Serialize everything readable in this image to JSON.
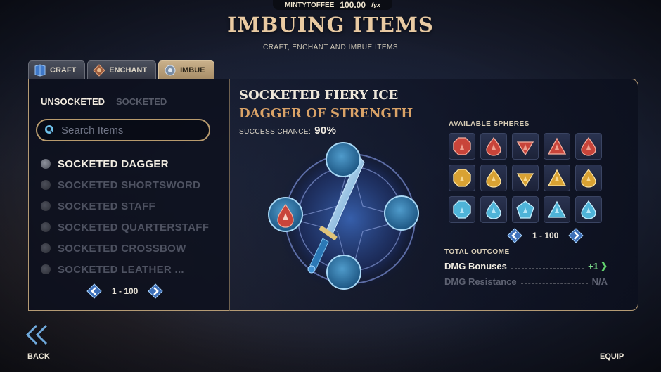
{
  "header": {
    "username": "MINTYTOFFEE",
    "balance": "100.00",
    "currency_unit": "fyx",
    "title": "IMBUING ITEMS",
    "subtitle": "CRAFT, ENCHANT AND IMBUE ITEMS"
  },
  "tabs": [
    {
      "label": "CRAFT",
      "icon": "book-icon",
      "active": false
    },
    {
      "label": "ENCHANT",
      "icon": "enchant-icon",
      "active": false
    },
    {
      "label": "IMBUE",
      "icon": "imbue-icon",
      "active": true
    }
  ],
  "left_panel": {
    "subtabs": [
      {
        "label": "UNSOCKETED",
        "active": true
      },
      {
        "label": "SOCKETED",
        "active": false
      }
    ],
    "search_placeholder": "Search Items",
    "items": [
      {
        "label": "SOCKETED DAGGER",
        "selected": true
      },
      {
        "label": "SOCKETED SHORTSWORD",
        "selected": false
      },
      {
        "label": "SOCKETED STAFF",
        "selected": false
      },
      {
        "label": "SOCKETED QUARTERSTAFF",
        "selected": false
      },
      {
        "label": "SOCKETED CROSSBOW",
        "selected": false
      },
      {
        "label": "SOCKETED LEATHER ...",
        "selected": false
      }
    ],
    "pager": "1 - 100"
  },
  "detail": {
    "name_line1": "SOCKETED FIERY ICE",
    "name_line2": "DAGGER OF STRENGTH",
    "success_label": "SUCCESS CHANCE:",
    "success_value": "90%",
    "sockets": [
      {
        "slot": "top",
        "filled": false
      },
      {
        "slot": "left",
        "filled": true,
        "element": "fire"
      },
      {
        "slot": "right",
        "filled": false
      },
      {
        "slot": "bottom",
        "filled": false
      }
    ]
  },
  "spheres": {
    "title": "AVAILABLE SPHERES",
    "grid": [
      [
        "red-octagon",
        "red-drop",
        "red-diamond",
        "red-triangle",
        "red-drop"
      ],
      [
        "gold-octagon",
        "gold-drop",
        "gold-diamond",
        "gold-triangle",
        "gold-drop"
      ],
      [
        "blue-octagon",
        "blue-drop",
        "blue-pentagon",
        "blue-triangle",
        "blue-drop"
      ]
    ],
    "pager": "1 - 100"
  },
  "outcome": {
    "title": "TOTAL OUTCOME",
    "stats": [
      {
        "name": "DMG Bonuses",
        "value": "+1"
      },
      {
        "name": "DMG Resistance",
        "value": "N/A"
      }
    ]
  },
  "footer": {
    "back_label": "BACK",
    "equip_label": "EQUIP"
  },
  "colors": {
    "accent_gold": "#e9caa2",
    "title_orange": "#d9a267",
    "panel_border": "#b59b74",
    "positive_green": "#7ee08c",
    "red_sphere": "#c8443a",
    "gold_sphere": "#d9a233",
    "blue_sphere": "#4fb4d8"
  }
}
